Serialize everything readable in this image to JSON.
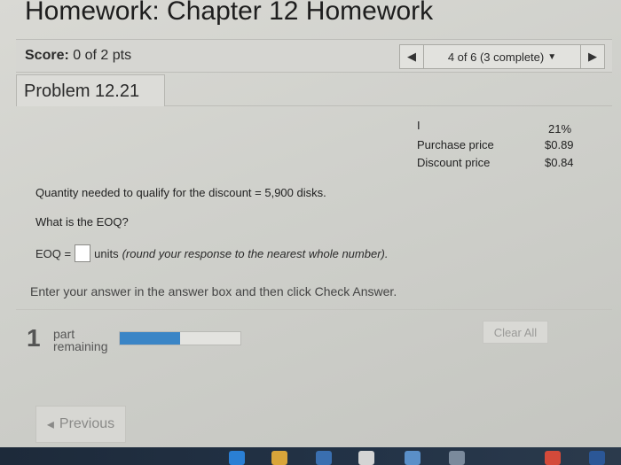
{
  "header": {
    "title": "Homework: Chapter 12 Homework"
  },
  "score": {
    "label": "Score:",
    "value": "0 of 2 pts"
  },
  "nav": {
    "prev_glyph": "◀",
    "next_glyph": "▶",
    "selected": "4 of 6 (3 complete)",
    "dropdown_glyph": "▼"
  },
  "problem": {
    "tab_label": "Problem 12.21"
  },
  "table": {
    "col_top": "I",
    "rows": [
      {
        "label": "",
        "value": "21%"
      },
      {
        "label": "Purchase price",
        "value": "$0.89"
      },
      {
        "label": "Discount price",
        "value": "$0.84"
      }
    ]
  },
  "question": {
    "quantity_text": "Quantity needed to qualify for the discount = 5,900 disks.",
    "prompt": "What is the EOQ?",
    "eoq_prefix": "EOQ =",
    "eoq_value": "",
    "eoq_suffix": "units",
    "eoq_instruction": "(round your response to the nearest whole number)."
  },
  "instruction": "Enter your answer in the answer box and then click Check Answer.",
  "parts": {
    "count": "1",
    "label_line1": "part",
    "label_line2": "remaining",
    "progress": 0.5
  },
  "buttons": {
    "clear_all": "Clear All",
    "previous": "Previous",
    "previous_glyph": "◂"
  },
  "taskbar": {
    "icons": [
      {
        "name": "edge-icon",
        "color": "#2a7fd4"
      },
      {
        "name": "files-icon",
        "color": "#d9a53a"
      },
      {
        "name": "store-icon",
        "color": "#3a6fb0"
      },
      {
        "name": "mail-icon",
        "color": "#d4d4d4"
      },
      {
        "name": "app-icon",
        "color": "#5a8fc8"
      },
      {
        "name": "people-icon",
        "color": "#7a8a9c"
      },
      {
        "name": "chrome-icon",
        "color": "#d44a3a"
      },
      {
        "name": "word-icon",
        "color": "#2b5797"
      }
    ]
  }
}
